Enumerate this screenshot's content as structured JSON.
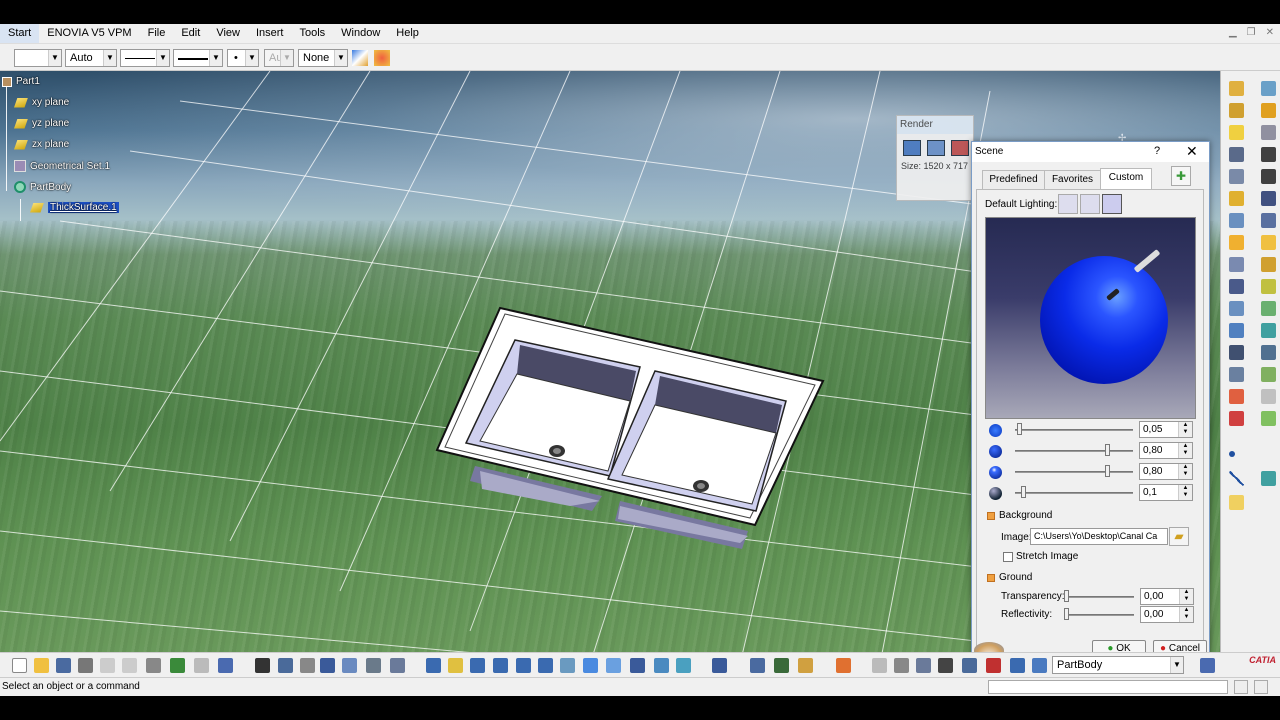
{
  "menubar": {
    "items": [
      "Start",
      "ENOVIA V5 VPM",
      "File",
      "Edit",
      "View",
      "Insert",
      "Tools",
      "Window",
      "Help"
    ]
  },
  "format_toolbar": {
    "color_combo": "Auto",
    "disabled_combo": "Aut",
    "layer_combo": "None"
  },
  "tree": {
    "root": "Part1",
    "items": [
      "xy plane",
      "yz plane",
      "zx plane",
      "Geometrical Set.1",
      "PartBody"
    ],
    "child": "ThickSurface.1"
  },
  "render_dialog": {
    "title": "Render",
    "size_text": "Size: 1520 x 717"
  },
  "scene_dialog": {
    "title": "Scene",
    "help": "?",
    "close": "✕",
    "tabs": [
      "Predefined",
      "Favorites",
      "Custom"
    ],
    "active_tab": "Custom",
    "default_lighting_label": "Default Lighting:",
    "slider_values": [
      "0,05",
      "0,80",
      "0,80",
      "0,1"
    ],
    "slider_levels": [
      0.02,
      0.8,
      0.8,
      0.05
    ],
    "background_label": "Background",
    "image_label": "Image:",
    "image_path": "C:\\Users\\Yo\\Desktop\\Canal Ca",
    "stretch_label": "Stretch Image",
    "ground_label": "Ground",
    "transparency_label": "Transparency:",
    "transparency_value": "0,00",
    "reflectivity_label": "Reflectivity:",
    "reflectivity_value": "0,00",
    "ok_label": "OK",
    "cancel_label": "Cancel"
  },
  "bottom_toolbar": {
    "current_body": "PartBody"
  },
  "status": {
    "text": "Select an object or a command"
  },
  "colors": {
    "accent": "#1c4fc4",
    "light_sphere": "#0a2be8"
  }
}
